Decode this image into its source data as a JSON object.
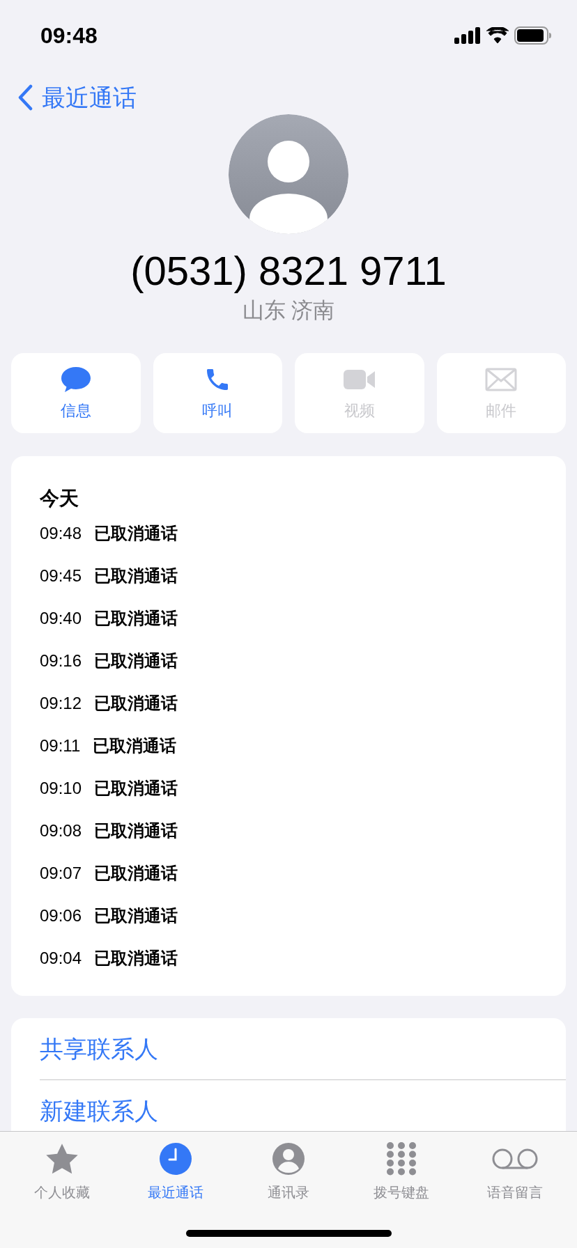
{
  "status_bar": {
    "time": "09:48"
  },
  "back": {
    "label": "最近通话"
  },
  "contact": {
    "number": "(0531) 8321 9711",
    "location": "山东 济南"
  },
  "actions": [
    {
      "kind": "message",
      "label": "信息",
      "disabled": false
    },
    {
      "kind": "call",
      "label": "呼叫",
      "disabled": false
    },
    {
      "kind": "video",
      "label": "视频",
      "disabled": true
    },
    {
      "kind": "mail",
      "label": "邮件",
      "disabled": true
    }
  ],
  "calls": {
    "day": "今天",
    "rows": [
      {
        "time": "09:48",
        "status": "已取消通话"
      },
      {
        "time": "09:45",
        "status": "已取消通话"
      },
      {
        "time": "09:40",
        "status": "已取消通话"
      },
      {
        "time": "09:16",
        "status": "已取消通话"
      },
      {
        "time": "09:12",
        "status": "已取消通话"
      },
      {
        "time": "09:11",
        "status": "已取消通话"
      },
      {
        "time": "09:10",
        "status": "已取消通话"
      },
      {
        "time": "09:08",
        "status": "已取消通话"
      },
      {
        "time": "09:07",
        "status": "已取消通话"
      },
      {
        "time": "09:06",
        "status": "已取消通话"
      },
      {
        "time": "09:04",
        "status": "已取消通话"
      }
    ]
  },
  "links": [
    "共享联系人",
    "新建联系人"
  ],
  "tabs": [
    {
      "kind": "favorites",
      "label": "个人收藏",
      "selected": false
    },
    {
      "kind": "recents",
      "label": "最近通话",
      "selected": true
    },
    {
      "kind": "contacts",
      "label": "通讯录",
      "selected": false
    },
    {
      "kind": "keypad",
      "label": "拨号键盘",
      "selected": false
    },
    {
      "kind": "voicemail",
      "label": "语音留言",
      "selected": false
    }
  ]
}
